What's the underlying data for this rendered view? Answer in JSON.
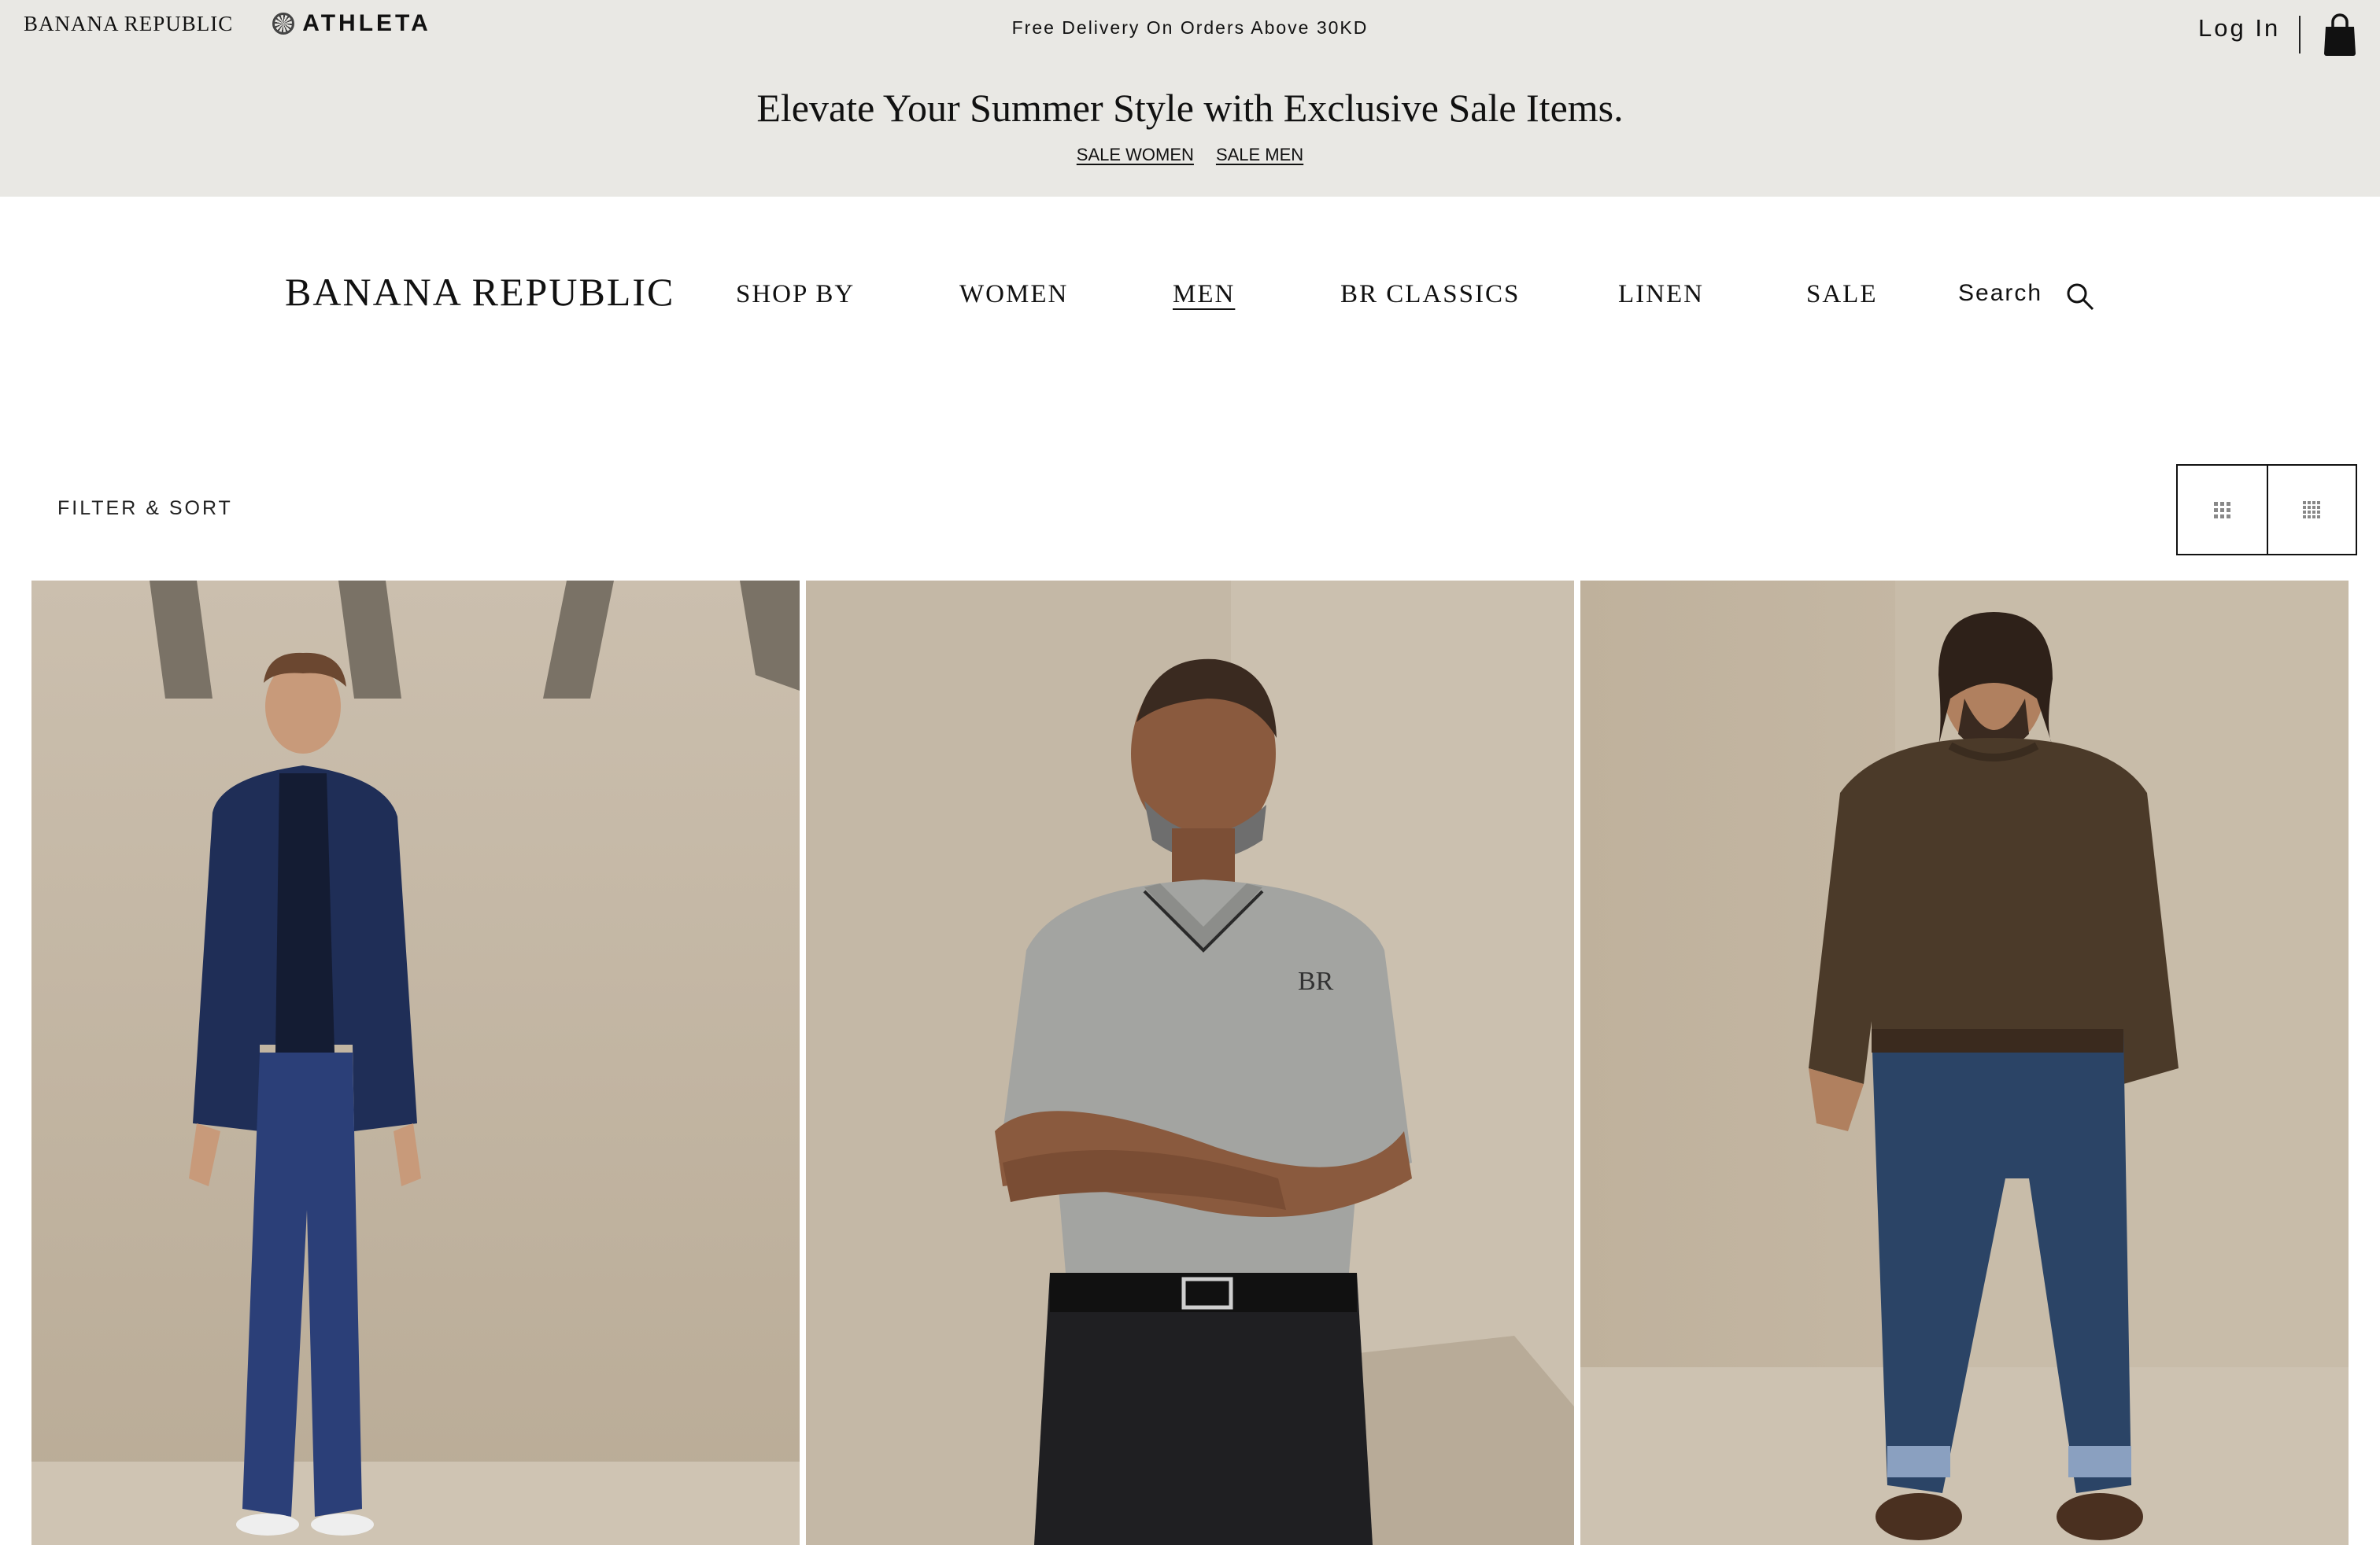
{
  "topbar": {
    "brand_banana": "BANANA REPUBLIC",
    "brand_athleta": "ATHLETA",
    "delivery_text": "Free Delivery On Orders Above 30KD",
    "login_label": "Log In"
  },
  "promo": {
    "headline": "Elevate Your Summer Style with Exclusive Sale Items.",
    "links": [
      "SALE WOMEN",
      "SALE MEN"
    ]
  },
  "nav": {
    "logo": "BANANA REPUBLIC",
    "items": [
      "SHOP BY",
      "WOMEN",
      "MEN",
      "BR CLASSICS",
      "LINEN",
      "SALE"
    ],
    "active_item": "MEN",
    "search_label": "Search"
  },
  "toolbar": {
    "filter_label": "FILTER & SORT"
  },
  "products": [
    {
      "image": "man-in-navy-suede-jacket-and-chinos"
    },
    {
      "image": "man-in-grey-polo-and-black-trousers"
    },
    {
      "image": "man-in-brown-sweater-and-jeans"
    }
  ],
  "colors": {
    "top_band": "#e9e8e4",
    "text": "#111111",
    "photo_background": "#c9bca9"
  }
}
